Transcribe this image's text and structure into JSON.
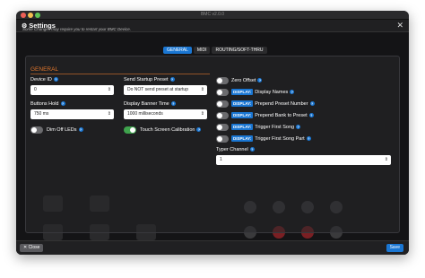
{
  "window": {
    "title": "BMC v2.0.0"
  },
  "modal": {
    "title": "Settings",
    "hint": "Some Changes may require you to restart your BMC Device.",
    "tabs": [
      {
        "label": "GENERAL",
        "active": true
      },
      {
        "label": "MIDI",
        "active": false
      },
      {
        "label": "ROUTING/SOFT-THRU",
        "active": false
      }
    ],
    "section_title": "GENERAL",
    "fields": {
      "device_id": {
        "label": "Device ID",
        "value": "0"
      },
      "send_startup_preset": {
        "label": "Send Startup Preset",
        "value": "Do NOT send preset at startup"
      },
      "buttons_hold": {
        "label": "Buttons Hold",
        "value": "750 ms"
      },
      "display_banner_time": {
        "label": "Display Banner Time",
        "value": "1000 milliseconds"
      },
      "typer_channel": {
        "label": "Typer Channel",
        "value": "1"
      }
    },
    "toggles": {
      "dim_off_leds": {
        "label": "Dim Off LEDs",
        "on": false
      },
      "touch_screen_calibration": {
        "label": "Touch Screen Calibration",
        "on": true
      },
      "zero_offset": {
        "label": "Zero Offset",
        "on": false
      },
      "display_names": {
        "badge": "DISPLAY:",
        "label": "Display Names",
        "on": false
      },
      "prepend_preset_number": {
        "badge": "DISPLAY:",
        "label": "Prepend Preset Number",
        "on": false
      },
      "prepend_bank_to_preset": {
        "badge": "DISPLAY:",
        "label": "Prepend Bank to Preset",
        "on": false
      },
      "trigger_first_song": {
        "badge": "DISPLAY:",
        "label": "Trigger First Song",
        "on": false
      },
      "trigger_first_song_part": {
        "badge": "DISPLAY:",
        "label": "Trigger First Song Part",
        "on": false
      }
    },
    "footer": {
      "close_label": "Close",
      "save_label": "Save"
    }
  },
  "colors": {
    "accent": "#1a76d2",
    "section": "#e0762c",
    "toggle_on": "#3fa34d",
    "background": "#1b1b1d"
  },
  "icons": {
    "settings": "gear-icon",
    "close": "close-icon",
    "help": "help-icon",
    "dropdown": "chevron-down-icon"
  }
}
